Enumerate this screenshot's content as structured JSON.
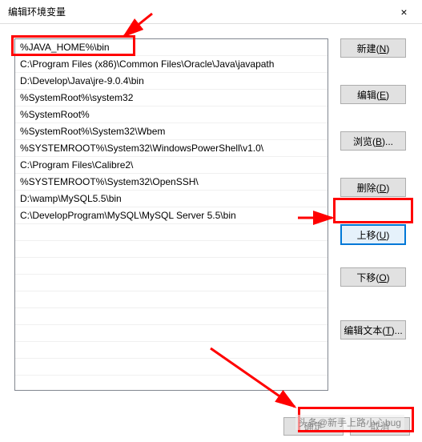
{
  "titlebar": {
    "title": "编辑环境变量",
    "close": "×"
  },
  "list": {
    "items": [
      "%JAVA_HOME%\\bin",
      "C:\\Program Files (x86)\\Common Files\\Oracle\\Java\\javapath",
      "D:\\Develop\\Java\\jre-9.0.4\\bin",
      "%SystemRoot%\\system32",
      "%SystemRoot%",
      "%SystemRoot%\\System32\\Wbem",
      "%SYSTEMROOT%\\System32\\WindowsPowerShell\\v1.0\\",
      "C:\\Program Files\\Calibre2\\",
      "%SYSTEMROOT%\\System32\\OpenSSH\\",
      "D:\\wamp\\MySQL5.5\\bin",
      "C:\\DevelopProgram\\MySQL\\MySQL Server 5.5\\bin"
    ]
  },
  "buttons": {
    "new": "新建(N)",
    "edit": "编辑(E)",
    "browse": "浏览(B)...",
    "delete": "删除(D)",
    "moveup": "上移(U)",
    "movedown": "下移(O)",
    "edittext": "编辑文本(T)..."
  },
  "footer": {
    "ok": "确定",
    "cancel": "取消"
  },
  "watermark": "头条@新手上路小心bug"
}
